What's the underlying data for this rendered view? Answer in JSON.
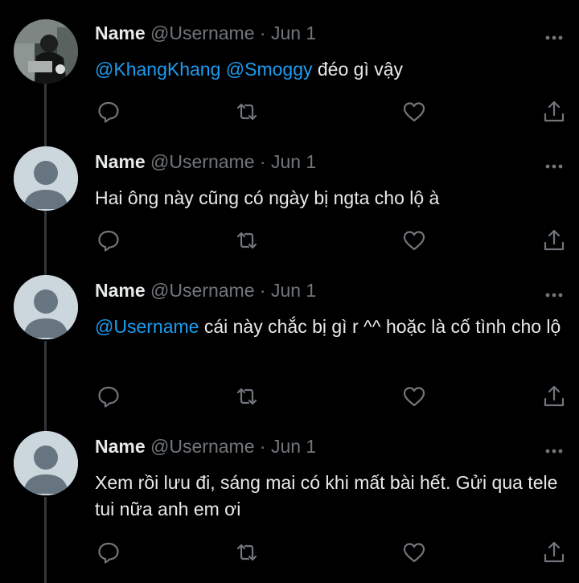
{
  "tweets": [
    {
      "name": "Name",
      "handle": "@Username",
      "separator": "·",
      "date": "Jun 1",
      "mention1": "@KhangKhang",
      "mention2": "@Smoggy",
      "text": "đéo gì vậy",
      "avatar": "photo"
    },
    {
      "name": "Name",
      "handle": "@Username",
      "separator": "·",
      "date": "Jun 1",
      "text": "Hai ông này cũng có ngày bị ngta cho lộ à",
      "avatar": "default-profile"
    },
    {
      "name": "Name",
      "handle": "@Username",
      "separator": "·",
      "date": "Jun 1",
      "mention1": "@Username",
      "text": "cái này chắc bị gì r ^^ hoặc là cố tình cho lộ",
      "avatar": "default-profile"
    },
    {
      "name": "Name",
      "handle": "@Username",
      "separator": "·",
      "date": "Jun 1",
      "text": "Xem rồi lưu đi, sáng mai có khi mất bài hết. Gửi qua tele tui nữa anh em ơi",
      "avatar": "default-profile"
    }
  ],
  "icons": [
    "reply-icon",
    "retweet-icon",
    "like-icon",
    "share-icon",
    "more-icon"
  ],
  "colors": {
    "background": "#000000",
    "text": "#e7e9ea",
    "muted": "#71767b",
    "mention": "#1d9bf0",
    "thread_line": "#333639"
  }
}
